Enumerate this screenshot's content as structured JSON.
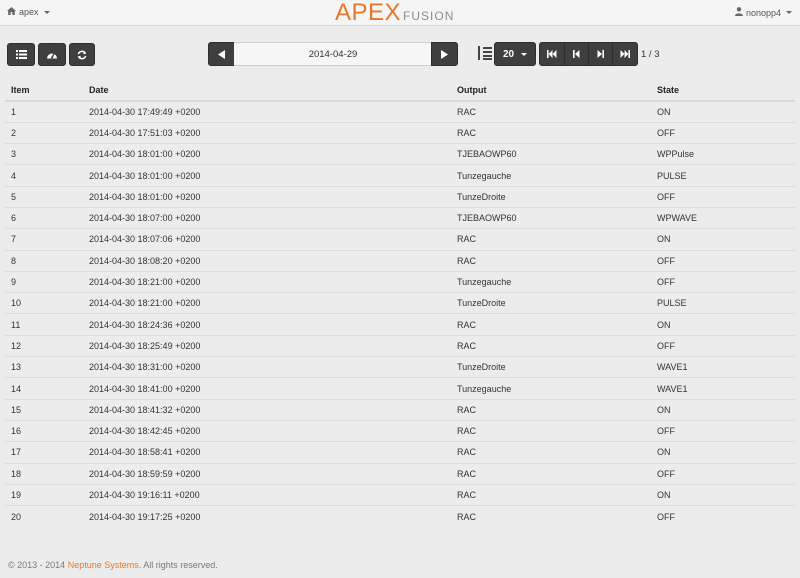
{
  "navbar": {
    "menu_label": "apex",
    "logo_main": "APEX",
    "logo_sub": "FUSION",
    "user_label": "nonopp4",
    "icons": {
      "menu": "home-icon",
      "user": "user-icon"
    }
  },
  "toolbar": {
    "view_icons": [
      "list-icon",
      "dashboard-icon",
      "refresh-icon"
    ],
    "date": "2014-04-29",
    "page_size": "20",
    "page_info": "1 / 3",
    "pager_icons": [
      "first-page-icon",
      "prev-page-icon",
      "next-page-icon",
      "last-page-icon"
    ]
  },
  "table": {
    "headers": [
      "Item",
      "Date",
      "Output",
      "State"
    ],
    "rows": [
      [
        "1",
        "2014-04-30 17:49:49 +0200",
        "RAC",
        "ON"
      ],
      [
        "2",
        "2014-04-30 17:51:03 +0200",
        "RAC",
        "OFF"
      ],
      [
        "3",
        "2014-04-30 18:01:00 +0200",
        "TJEBAOWP60",
        "WPPulse"
      ],
      [
        "4",
        "2014-04-30 18:01:00 +0200",
        "Tunzegauche",
        "PULSE"
      ],
      [
        "5",
        "2014-04-30 18:01:00 +0200",
        "TunzeDroite",
        "OFF"
      ],
      [
        "6",
        "2014-04-30 18:07:00 +0200",
        "TJEBAOWP60",
        "WPWAVE"
      ],
      [
        "7",
        "2014-04-30 18:07:06 +0200",
        "RAC",
        "ON"
      ],
      [
        "8",
        "2014-04-30 18:08:20 +0200",
        "RAC",
        "OFF"
      ],
      [
        "9",
        "2014-04-30 18:21:00 +0200",
        "Tunzegauche",
        "OFF"
      ],
      [
        "10",
        "2014-04-30 18:21:00 +0200",
        "TunzeDroite",
        "PULSE"
      ],
      [
        "11",
        "2014-04-30 18:24:36 +0200",
        "RAC",
        "ON"
      ],
      [
        "12",
        "2014-04-30 18:25:49 +0200",
        "RAC",
        "OFF"
      ],
      [
        "13",
        "2014-04-30 18:31:00 +0200",
        "TunzeDroite",
        "WAVE1"
      ],
      [
        "14",
        "2014-04-30 18:41:00 +0200",
        "Tunzegauche",
        "WAVE1"
      ],
      [
        "15",
        "2014-04-30 18:41:32 +0200",
        "RAC",
        "ON"
      ],
      [
        "16",
        "2014-04-30 18:42:45 +0200",
        "RAC",
        "OFF"
      ],
      [
        "17",
        "2014-04-30 18:58:41 +0200",
        "RAC",
        "ON"
      ],
      [
        "18",
        "2014-04-30 18:59:59 +0200",
        "RAC",
        "OFF"
      ],
      [
        "19",
        "2014-04-30 19:16:11 +0200",
        "RAC",
        "ON"
      ],
      [
        "20",
        "2014-04-30 19:17:25 +0200",
        "RAC",
        "OFF"
      ]
    ]
  },
  "footer": {
    "prefix": "© 2013 - 2014",
    "brand": "Neptune Systems.",
    "suffix": "All rights reserved."
  },
  "colors": {
    "accent": "#e8762b",
    "button": "#3f3f3f",
    "background": "#ececec"
  }
}
